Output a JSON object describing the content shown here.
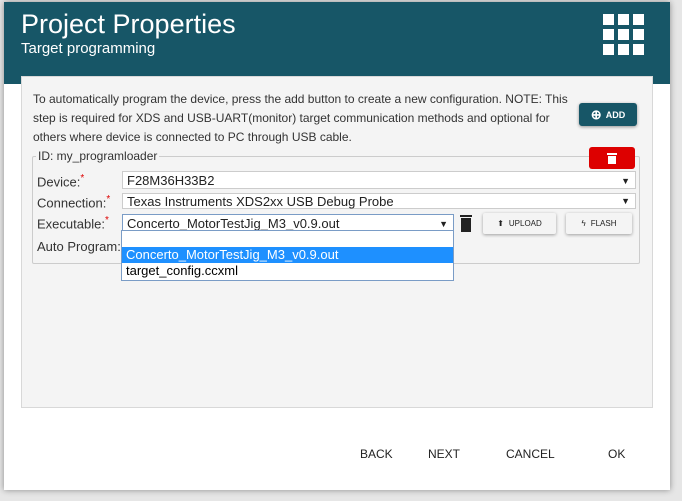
{
  "header": {
    "title": "Project Properties",
    "subtitle": "Target programming"
  },
  "note": "To automatically program the device, press the add button to create a new configuration. NOTE: This step is required for XDS and USB-UART(monitor) target communication methods and optional for others where device is connected to PC through USB cable.",
  "add_label": "ADD",
  "config": {
    "id_label": "ID: my_programloader",
    "device_label": "Device:",
    "device_value": "F28M36H33B2",
    "connection_label": "Connection:",
    "connection_value": "Texas Instruments XDS2xx USB Debug Probe",
    "executable_label": "Executable:",
    "executable_value": "Concerto_MotorTestJig_M3_v0.9.out",
    "auto_program_label": "Auto Program:",
    "required_mark": "*",
    "upload_label": "UPLOAD",
    "flash_label": "FLASH"
  },
  "dropdown": {
    "options": [
      "",
      "Concerto_MotorTestJig_M3_v0.9.out",
      "target_config.ccxml"
    ]
  },
  "footer": {
    "back": "BACK",
    "next": "NEXT",
    "cancel": "CANCEL",
    "ok": "OK"
  }
}
